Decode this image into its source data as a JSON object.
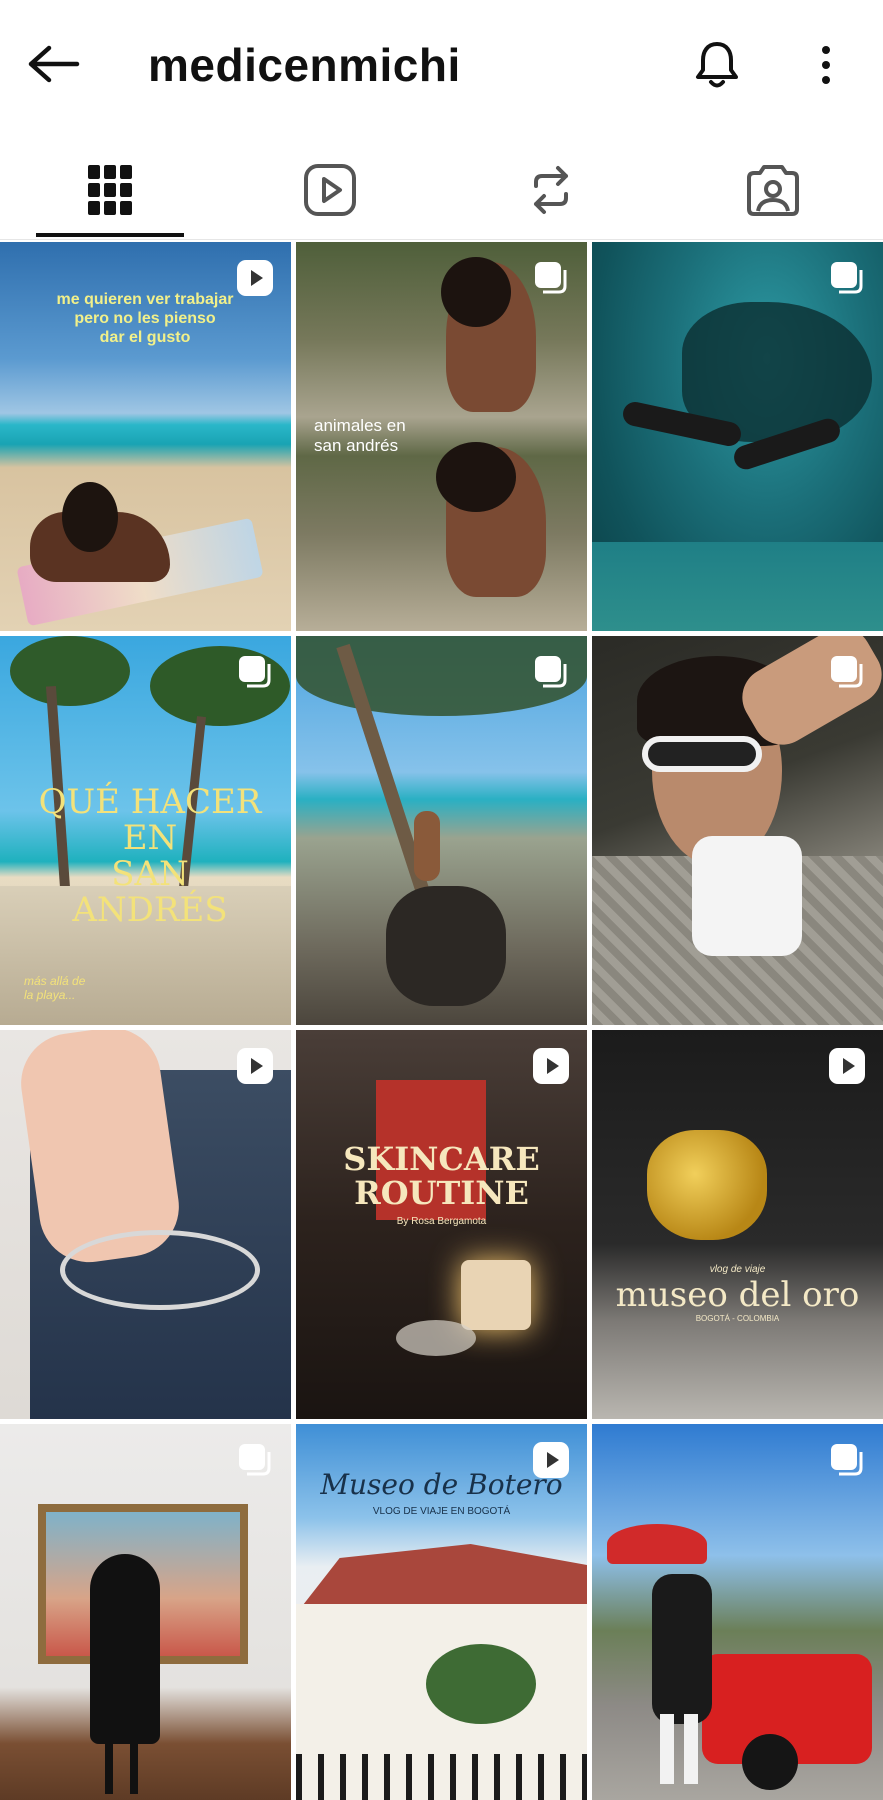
{
  "header": {
    "username": "medicenmichi",
    "back_icon": "arrow-left-icon",
    "bell_icon": "bell-icon",
    "more_icon": "more-vertical-icon"
  },
  "tabs": [
    {
      "name": "posts",
      "icon": "grid-icon",
      "active": true
    },
    {
      "name": "reels",
      "icon": "reels-icon",
      "active": false
    },
    {
      "name": "reposts",
      "icon": "repost-icon",
      "active": false
    },
    {
      "name": "tagged",
      "icon": "tagged-icon",
      "active": false
    }
  ],
  "posts": [
    {
      "type": "reel",
      "text": [
        "me quieren ver trabajar",
        "pero no les pienso",
        "dar el gusto"
      ]
    },
    {
      "type": "carousel",
      "text": [
        "animales en",
        "san andrés"
      ]
    },
    {
      "type": "carousel",
      "text": []
    },
    {
      "type": "carousel",
      "text": [
        "QUÉ HACER EN",
        "SAN ANDRÉS",
        "más allá de",
        "la playa..."
      ]
    },
    {
      "type": "carousel",
      "text": []
    },
    {
      "type": "carousel",
      "text": []
    },
    {
      "type": "reel",
      "text": []
    },
    {
      "type": "reel",
      "text": [
        "SKINCARE",
        "ROUTINE",
        "By Rosa Bergamota"
      ]
    },
    {
      "type": "reel",
      "text": [
        "vlog de viaje",
        "museo del oro",
        "BOGOTÁ - COLOMBIA"
      ]
    },
    {
      "type": "carousel",
      "text": []
    },
    {
      "type": "reel",
      "text": [
        "Museo de Botero",
        "VLOG DE VIAJE EN BOGOTÁ"
      ]
    },
    {
      "type": "carousel",
      "text": []
    }
  ]
}
